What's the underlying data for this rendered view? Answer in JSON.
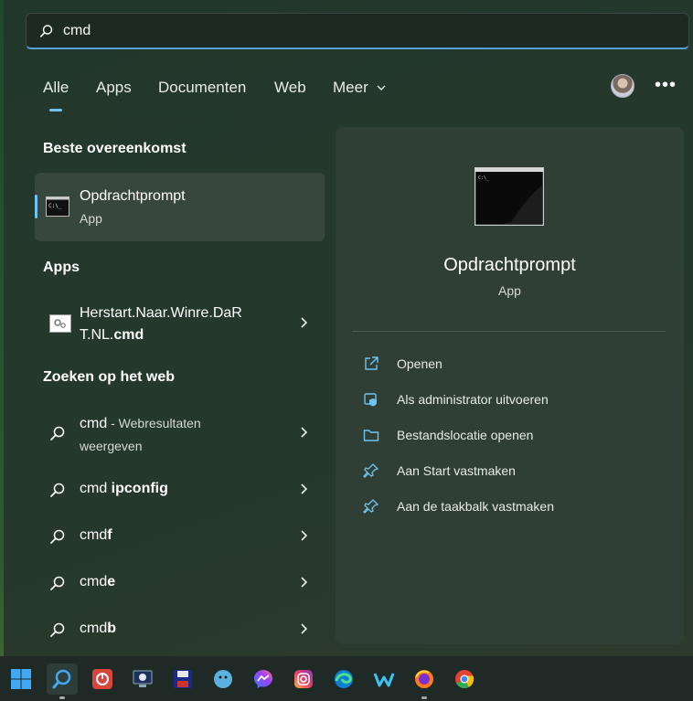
{
  "search": {
    "value": "cmd"
  },
  "tabs": [
    {
      "label": "Alle"
    },
    {
      "label": "Apps"
    },
    {
      "label": "Documenten"
    },
    {
      "label": "Web"
    },
    {
      "label": "Meer"
    }
  ],
  "best_match": {
    "section": "Beste overeenkomst",
    "title": "Opdrachtprompt",
    "type": "App"
  },
  "apps": {
    "section": "Apps",
    "items": [
      {
        "line1": "Herstart.Naar.Winre.DaR",
        "line2_plain": "T.NL.",
        "line2_bold": "cmd"
      }
    ]
  },
  "web": {
    "section": "Zoeken op het web",
    "items": [
      {
        "query": "cmd",
        "suffix": " - Webresultaten",
        "suffix2": "weergeven"
      },
      {
        "query": "cmd",
        "bold": " ipconfig"
      },
      {
        "query": "cmd",
        "bold": "f"
      },
      {
        "query": "cmd",
        "bold": "e"
      },
      {
        "query": "cmd",
        "bold": "b"
      }
    ]
  },
  "detail": {
    "title": "Opdrachtprompt",
    "type": "App",
    "actions": [
      {
        "label": "Openen",
        "icon": "open-icon"
      },
      {
        "label": "Als administrator uitvoeren",
        "icon": "shield-icon"
      },
      {
        "label": "Bestandslocatie openen",
        "icon": "folder-icon"
      },
      {
        "label": "Aan Start vastmaken",
        "icon": "pin-icon"
      },
      {
        "label": "Aan de taakbalk vastmaken",
        "icon": "pin-icon"
      }
    ]
  },
  "taskbar": [
    "windows-start-icon",
    "search-icon",
    "power-app-icon",
    "monitor-app-icon",
    "save-app-icon",
    "globe-app-icon",
    "messenger-icon",
    "instagram-icon",
    "edge-icon",
    "wondershare-icon",
    "firefox-icon",
    "chrome-icon"
  ],
  "colors": {
    "accent": "#6fc3f0"
  }
}
